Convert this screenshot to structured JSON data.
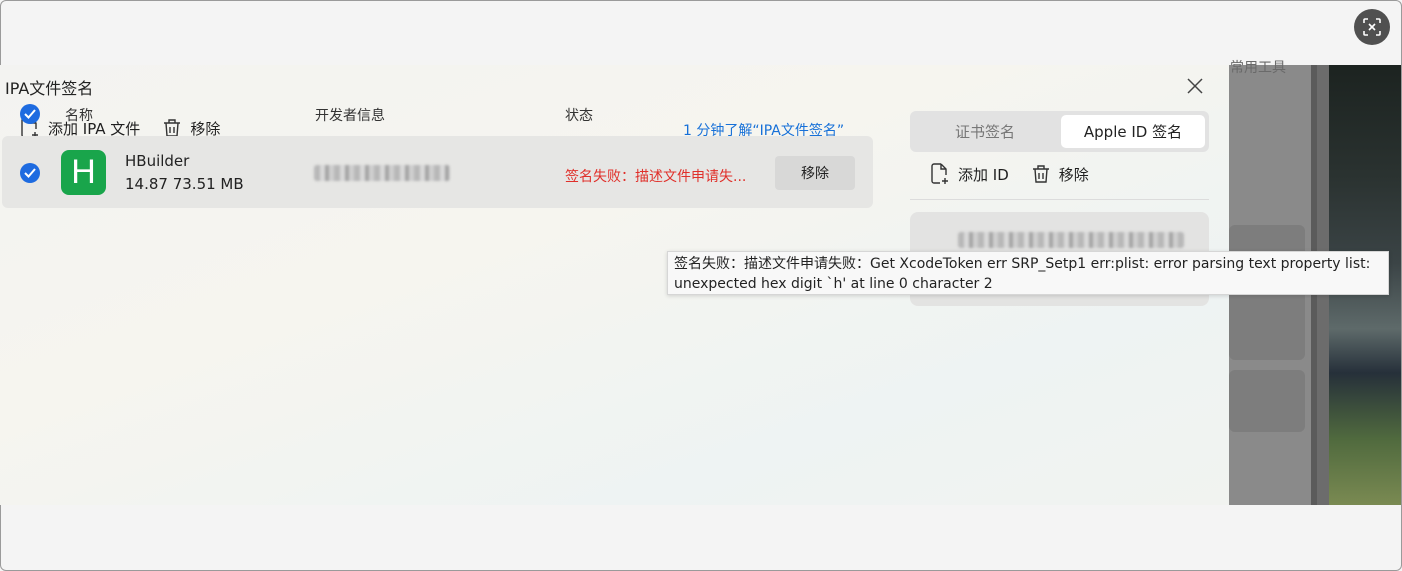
{
  "background_app": {
    "partial_text": "常用工具"
  },
  "dialog": {
    "title": "IPA文件签名",
    "toolbar": {
      "add_label": "添加 IPA 文件",
      "remove_label": "移除"
    },
    "learn_link": "1 分钟了解“IPA文件签名”",
    "table": {
      "headers": {
        "name": "名称",
        "developer": "开发者信息",
        "status": "状态"
      },
      "rows": [
        {
          "icon_letter": "H",
          "name": "HBuilder",
          "meta": "14.87   73.51 MB",
          "status": "签名失败：描述文件申请失...",
          "remove_label": "移除"
        }
      ]
    },
    "tooltip": "签名失败：描述文件申请失败：Get XcodeToken err SRP_Setp1 err:plist: error parsing text property list: unexpected hex digit `h' at line 0 character 2",
    "right_panel": {
      "segments": [
        "证书签名",
        "Apple ID 签名"
      ],
      "selected_segment": "Apple ID 签名",
      "toolbar": {
        "add_label": "添加 ID",
        "remove_label": "移除"
      }
    }
  },
  "colors": {
    "accent": "#1e6be0",
    "error": "#e0302a",
    "app_icon": "#19a54b",
    "link": "#1670d8"
  }
}
